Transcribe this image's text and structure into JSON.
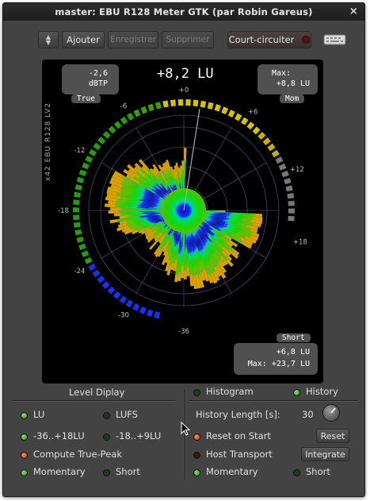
{
  "window": {
    "title": "master: EBU R128 Meter GTK (par Robin Gareus)",
    "close_glyph": "×"
  },
  "toolbar": {
    "add_label": "Ajouter",
    "save_label": "Enregistrer",
    "delete_label": "Supprimer",
    "bypass_label": "Court-circuiter"
  },
  "meter": {
    "side_label": "x42 EBU R128 LV2",
    "big_value": "+8,2 LU",
    "true_peak": {
      "value": "-2,6",
      "unit": "dBTP",
      "tab": "True"
    },
    "max_box": {
      "line1": "Max:",
      "line2": "+8,8 LU",
      "tab": "Mom"
    },
    "short_box": {
      "tab": "Short",
      "line1": "+6,8 LU",
      "line2": "Max: +23,7 LU"
    },
    "scale_labels": [
      "+0",
      "+6",
      "+12",
      "+18",
      "-36",
      "-30",
      "-24",
      "-18",
      "-12",
      "-6"
    ]
  },
  "level_display": {
    "title": "Level Diplay",
    "lu": "LU",
    "lufs": "LUFS",
    "range1": "-36..+18LU",
    "range2": "-18..+9LU",
    "true_peak": "Compute True-Peak",
    "momentary": "Momentary",
    "short": "Short"
  },
  "right_panel": {
    "histogram": "Histogram",
    "history": "History",
    "history_length_label": "History Length [s]:",
    "history_length_value": "30",
    "reset_on_start": "Reset on Start",
    "reset_button": "Reset",
    "host_transport": "Host Transport",
    "integrate_button": "Integrate",
    "momentary": "Momentary",
    "short": "Short"
  }
}
